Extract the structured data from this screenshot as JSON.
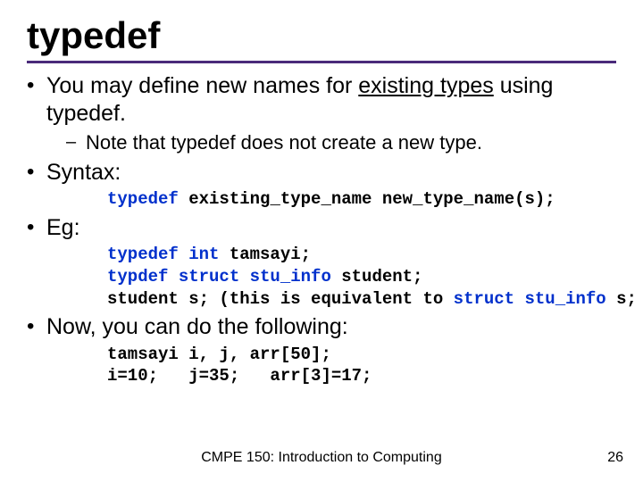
{
  "title": "typedef",
  "bullets": [
    {
      "text_parts": [
        "You may define new names for ",
        "existing types",
        " using typedef."
      ],
      "underline_index": 1,
      "sub_dash": [
        "Note that typedef does not create a new type."
      ]
    },
    {
      "text_parts": [
        "Syntax:"
      ],
      "code_lines": [
        {
          "segments": [
            {
              "t": "typedef",
              "kw": true
            },
            {
              "t": " existing_type_name new_type_name(s);",
              "kw": false
            }
          ]
        }
      ]
    },
    {
      "text_parts": [
        "Eg:"
      ],
      "code_lines": [
        {
          "segments": [
            {
              "t": "typedef int",
              "kw": true
            },
            {
              "t": " tamsayi;",
              "kw": false
            }
          ]
        },
        {
          "segments": [
            {
              "t": "typdef struct stu_info",
              "kw": true
            },
            {
              "t": " student;",
              "kw": false
            }
          ]
        },
        {
          "segments": [
            {
              "t": "student s; ",
              "kw": false
            },
            {
              "t": "(this is equivalent to ",
              "kw": false
            },
            {
              "t": "struct stu_info",
              "kw": true
            },
            {
              "t": " s; )",
              "kw": false
            }
          ]
        }
      ]
    },
    {
      "text_parts": [
        "Now, you can do the following:"
      ],
      "code_lines": [
        {
          "segments": [
            {
              "t": "tamsayi i, j, arr[50];",
              "kw": false
            }
          ]
        },
        {
          "segments": [
            {
              "t": "i=10;   j=35;   arr[3]=17;",
              "kw": false
            }
          ]
        }
      ]
    }
  ],
  "footer": "CMPE 150: Introduction to Computing",
  "page_number": "26"
}
